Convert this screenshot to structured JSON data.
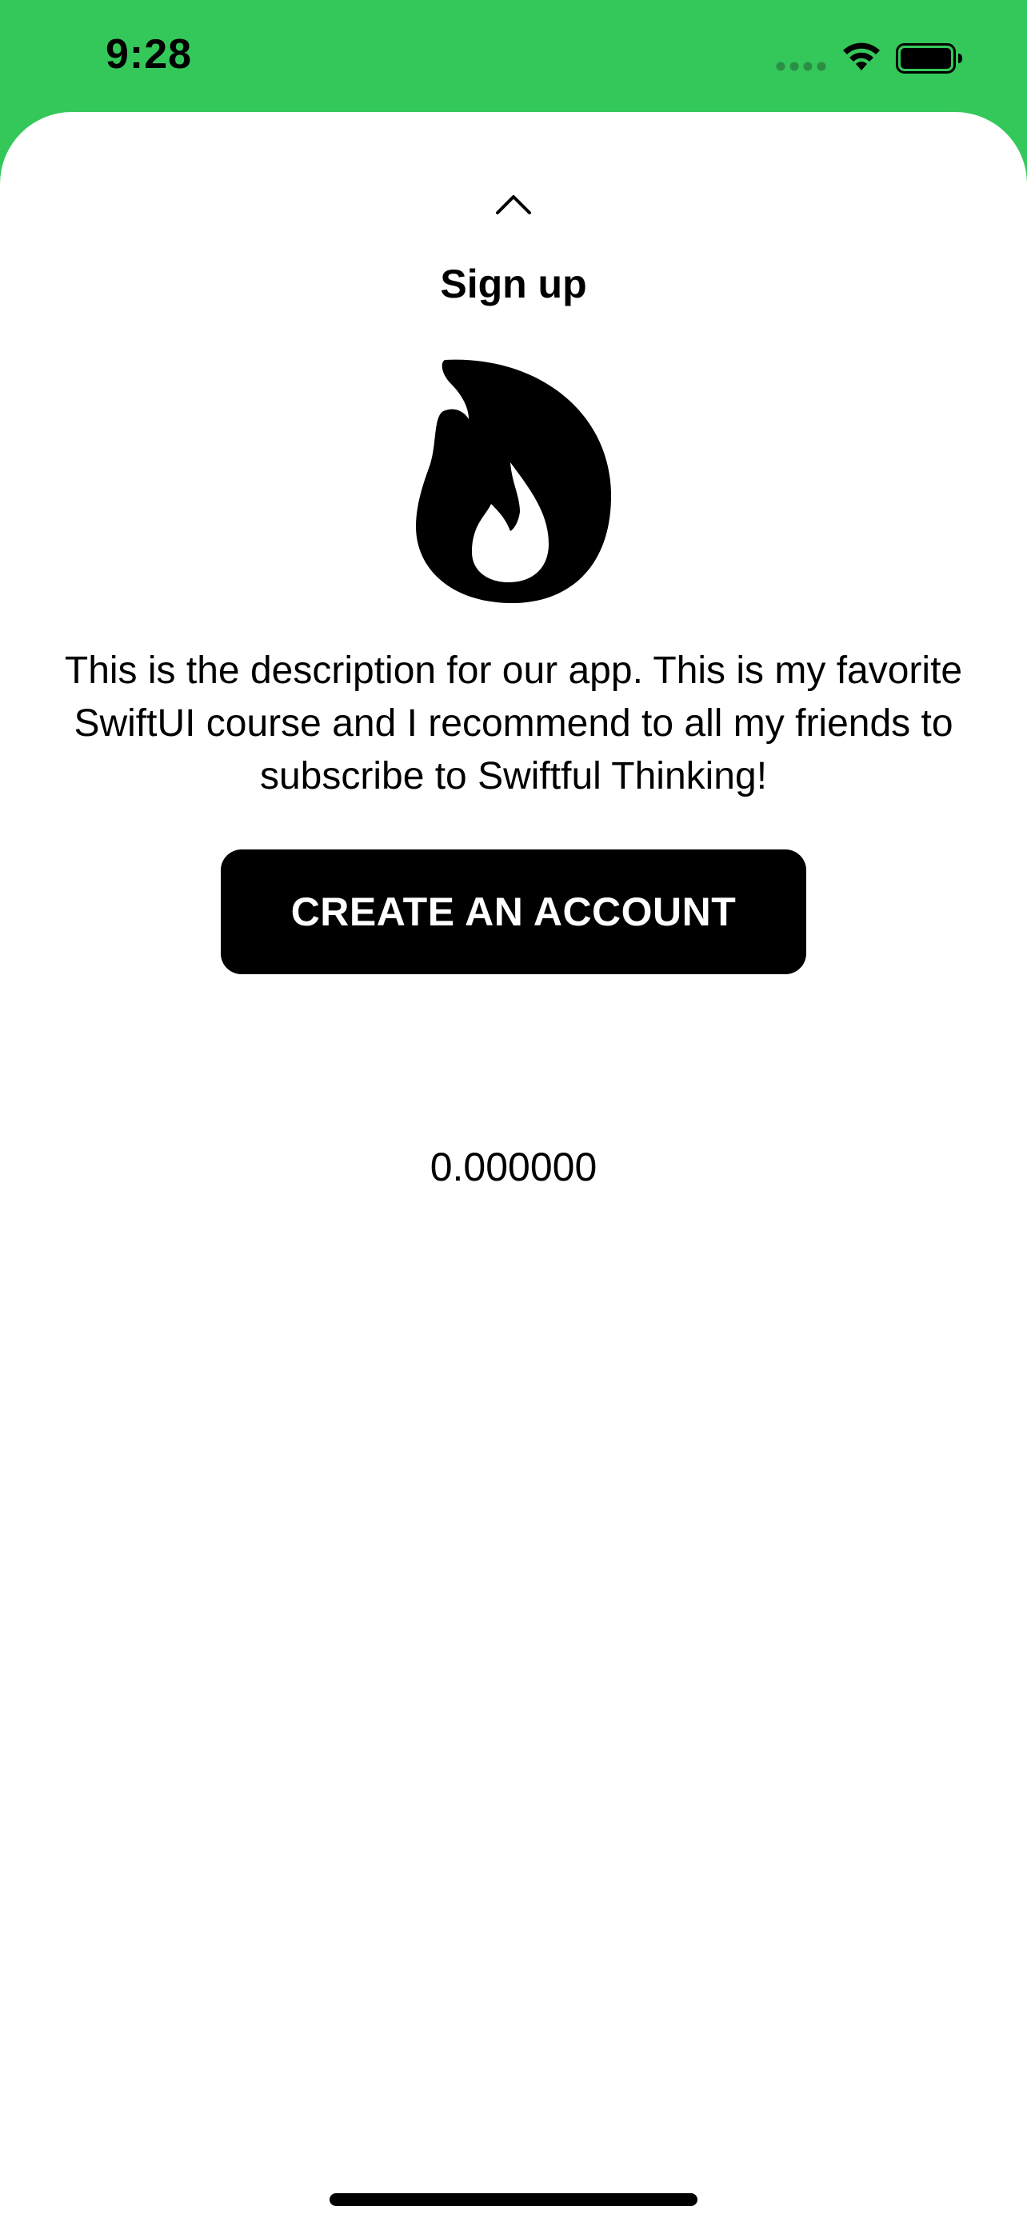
{
  "status_bar": {
    "time": "9:28",
    "signal_icon": "cellular-signal-icon",
    "wifi_icon": "wifi-icon",
    "battery_icon": "battery-icon"
  },
  "sheet": {
    "handle_icon": "chevron-up-icon",
    "title": "Sign up",
    "hero_icon": "flame-icon",
    "description": "This is the description for our app. This is my favorite SwiftUI course and I recommend to all my friends to subscribe to Swiftful Thinking!",
    "button_label": "CREATE AN ACCOUNT",
    "offset_value": "0.000000"
  },
  "colors": {
    "background": "#34C85A",
    "sheet": "#FFFFFF",
    "button": "#000000",
    "button_text": "#FFFFFF"
  }
}
